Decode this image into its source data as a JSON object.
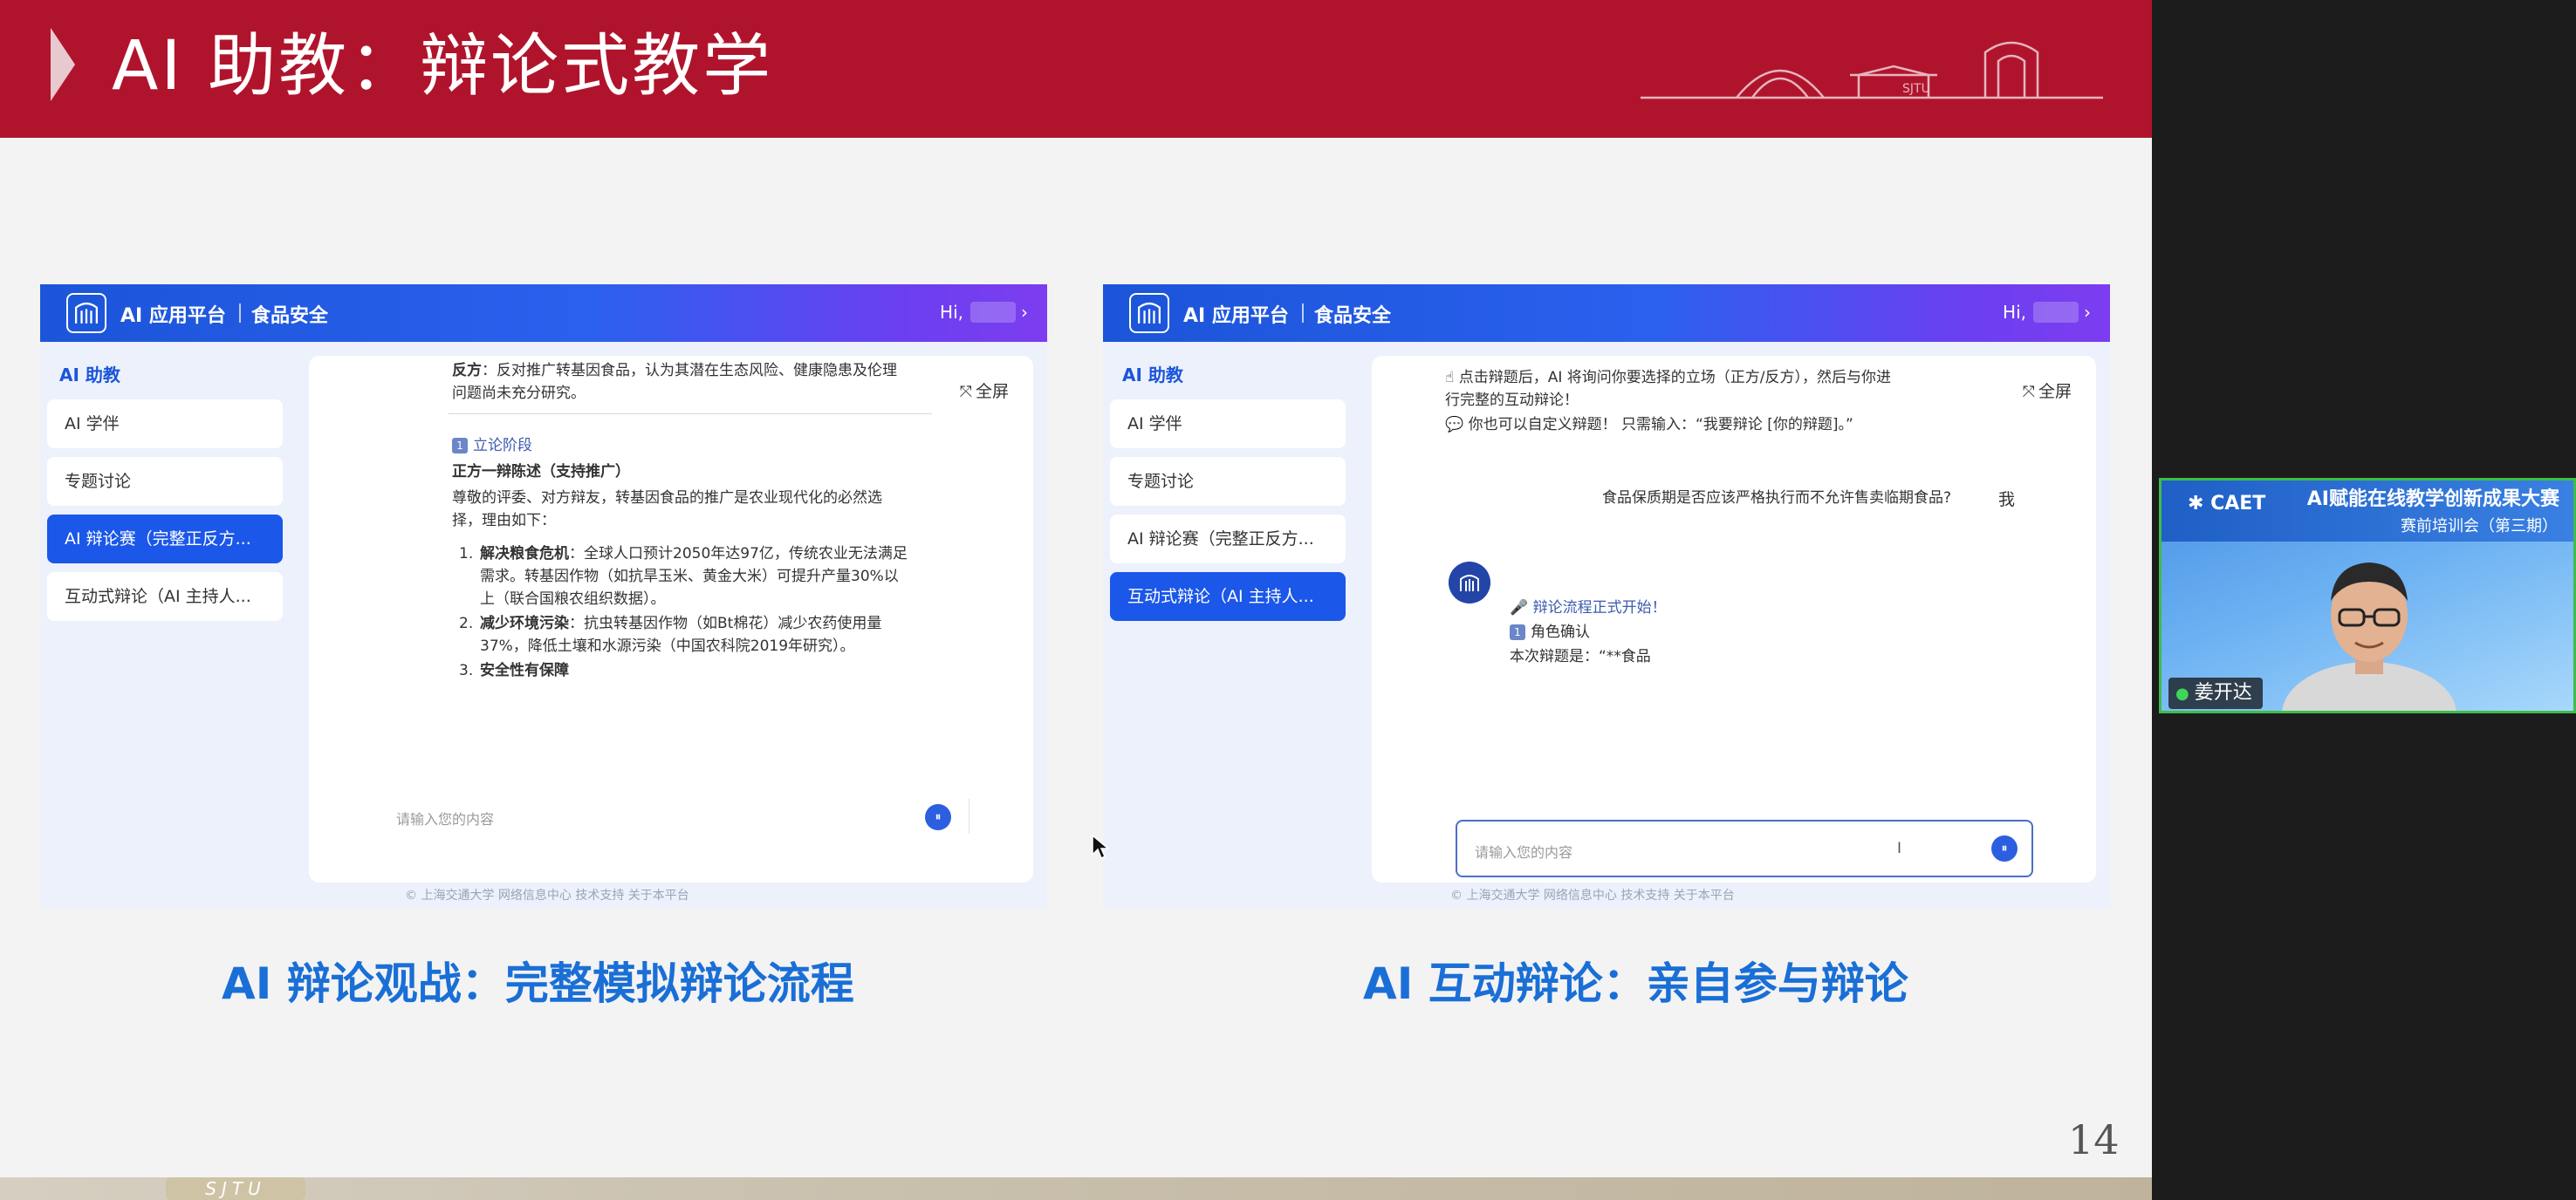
{
  "slide": {
    "title": "AI 助教：辩论式教学",
    "page_number": "14",
    "bottom_strip_label": "SJTU",
    "caption_left": "AI 辩论观战：完整模拟辩论流程",
    "caption_right": "AI 互动辩论：亲自参与辩论",
    "colors": {
      "header": "#b0142c",
      "caption": "#1a6fd6"
    }
  },
  "panel_left": {
    "platform_name": "AI 应用平台",
    "course_name": "食品安全",
    "greeting": "Hi,",
    "sidebar_title": "AI 助教",
    "sidebar_items": [
      {
        "label": "AI 学伴",
        "active": false
      },
      {
        "label": "专题讨论",
        "active": false
      },
      {
        "label": "AI 辩论赛（完整正反方...",
        "active": true
      },
      {
        "label": "互动式辩论（AI 主持人...",
        "active": false
      }
    ],
    "fullscreen_label": "全屏",
    "content": {
      "line1_bold": "反方",
      "line1": "：反对推广转基因食品，认为其潜在生态风险、健康隐患及伦理",
      "line2": "问题尚未充分研究。",
      "stage_badge": "1",
      "stage_heading": "立论阶段",
      "speaker": "正方一辩陈述（支持推广）",
      "intro1": "尊敬的评委、对方辩友，转基因食品的推广是农业现代化的必然选",
      "intro2": "择，理由如下：",
      "points": [
        {
          "num": "1.",
          "bold": "解决粮食危机",
          "text1": "：全球人口预计2050年达97亿，传统农业无法满足",
          "text2": "需求。转基因作物（如抗旱玉米、黄金大米）可提升产量30%以",
          "text3": "上（联合国粮农组织数据）。"
        },
        {
          "num": "2.",
          "bold": "减少环境污染",
          "text1": "：抗虫转基因作物（如Bt棉花）减少农药使用量",
          "text2": "37%，降低土壤和水源污染（中国农科院2019年研究）。"
        },
        {
          "num": "3.",
          "bold": "安全性有保障"
        }
      ]
    },
    "input_placeholder": "请输入您的内容",
    "footer": "© 上海交通大学 网络信息中心 技术支持   关于本平台"
  },
  "panel_right": {
    "platform_name": "AI 应用平台",
    "course_name": "食品安全",
    "greeting": "Hi,",
    "sidebar_title": "AI 助教",
    "sidebar_items": [
      {
        "label": "AI 学伴",
        "active": false
      },
      {
        "label": "专题讨论",
        "active": false
      },
      {
        "label": "AI 辩论赛（完整正反方...",
        "active": false
      },
      {
        "label": "互动式辩论（AI 主持人...",
        "active": true
      }
    ],
    "fullscreen_label": "全屏",
    "content": {
      "intro1": "点击辩题后，AI 将询问你要选择的立场（正方/反方），然后与你进",
      "intro2": "行完整的互动辩论！",
      "custom": "你也可以自定义辩题！ 只需输入：“我要辩论 [你的辩题]。”",
      "user_message": "食品保质期是否应该严格执行而不允许售卖临期食品?",
      "me_label": "我",
      "bot_start": "辩论流程正式开始！",
      "role_badge": "1",
      "role_confirm": "角色确认",
      "topic_line": "本次辩题是：“**食品"
    },
    "input_placeholder": "请输入您的内容",
    "footer": "© 上海交通大学 网络信息中心 技术支持   关于本平台"
  },
  "video_tile": {
    "logo": "CAET",
    "title": "AI赋能在线教学创新成果大赛",
    "subtitle": "赛前培训会（第三期）",
    "participant_name": "姜开达",
    "border_color": "#3dbd4a"
  }
}
